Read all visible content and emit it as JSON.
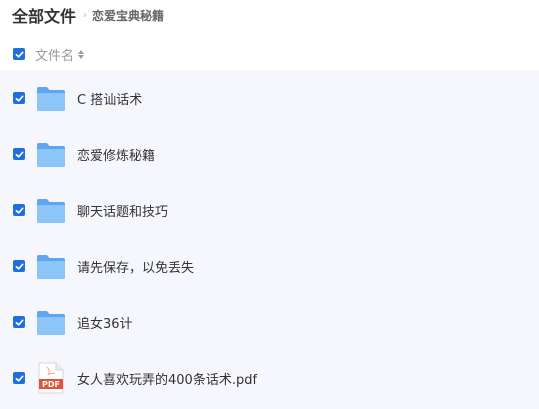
{
  "breadcrumb": {
    "root": "全部文件",
    "current": "恋爱宝典秘籍"
  },
  "header": {
    "column_title": "文件名"
  },
  "files": [
    {
      "name": "C 搭讪话术",
      "type": "folder"
    },
    {
      "name": "恋爱修炼秘籍",
      "type": "folder"
    },
    {
      "name": "聊天话题和技巧",
      "type": "folder"
    },
    {
      "name": "请先保存，以免丢失",
      "type": "folder"
    },
    {
      "name": "追女36计",
      "type": "folder"
    },
    {
      "name": "女人喜欢玩弄的400条话术.pdf",
      "type": "pdf",
      "badge": "PDF"
    }
  ],
  "colors": {
    "accent": "#1f6fe0",
    "list_bg": "#f6f7fc",
    "folder": "#7ab8f5",
    "pdf": "#e0533c"
  }
}
